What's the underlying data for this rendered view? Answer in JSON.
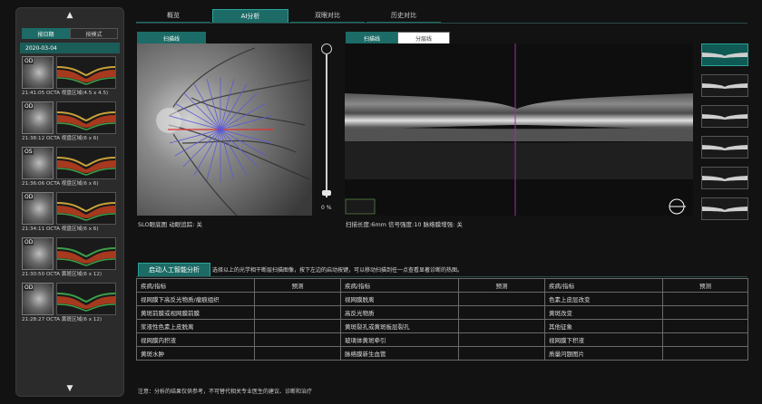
{
  "sidebar": {
    "tabs": [
      "按日期",
      "按模式"
    ],
    "date": "2020-03-04",
    "scans": [
      {
        "eye": "OD",
        "caption": "21:41:05 OCTA 视盘区域(4.5 x 4.5)",
        "octa": true
      },
      {
        "eye": "OD",
        "caption": "21:38:12 OCTA 视盘区域(6 x 6)",
        "octa": true
      },
      {
        "eye": "OS",
        "caption": "21:36:06 OCTA 视盘区域(6 x 6)",
        "octa": true
      },
      {
        "eye": "OD",
        "caption": "21:34:11 OCTA 视盘区域(6 x 6)",
        "octa": true
      },
      {
        "eye": "OD",
        "caption": "21:30:50 OCTA 黄斑区域(6 x 12)",
        "octa": false
      },
      {
        "eye": "OD",
        "caption": "21:28:27 OCTA 黄斑区域(6 x 12)",
        "octa": false
      }
    ]
  },
  "top_tabs": [
    "概览",
    "AI分析",
    "双眼对比",
    "历史对比"
  ],
  "slo": {
    "tab": "扫描线",
    "caption": "SLO眼底图    动眼追踪: 关",
    "brightness": "0 %"
  },
  "bscan": {
    "tabs": [
      "扫描线",
      "分层线"
    ],
    "caption": "扫描长度:6mm    信号强度:10    脉络膜增强: 关"
  },
  "ai": {
    "button": "启动人工智能分析",
    "hint": "选择以上的光学相干断层扫描图像，按下左边的启动按键，可以移动扫描到任一点查看显著诊断的热图。",
    "headers": [
      "疾病/指标",
      "预测"
    ],
    "rows": [
      [
        "视网膜下高反光物质/瘤痕组织",
        "",
        "视网膜脱离",
        "",
        "色素上皮层改变",
        ""
      ],
      [
        "黄斑前膜或视网膜前膜",
        "",
        "高反光物质",
        "",
        "黄斑改变",
        ""
      ],
      [
        "浆液性色素上皮脱离",
        "",
        "黄斑裂孔或黄斑板层裂孔",
        "",
        "其他征象",
        ""
      ],
      [
        "视网膜内积液",
        "",
        "玻璃体黄斑牵引",
        "",
        "视网膜下积液",
        ""
      ],
      [
        "黄斑水肿",
        "",
        "脉络膜新生血管",
        "",
        "质量问题图片",
        ""
      ]
    ],
    "note": "注意：分析的结果仅供参考，不可替代相关专业医生的建议、诊断和治疗"
  }
}
